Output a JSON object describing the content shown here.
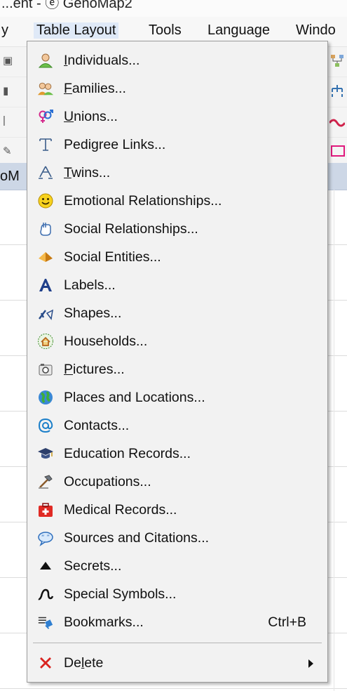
{
  "window": {
    "title_fragment": "...ent - ⓔ GenoMap2"
  },
  "menubar": {
    "items": [
      {
        "label": "y"
      },
      {
        "label": "Table Layout"
      },
      {
        "label": "Tools"
      },
      {
        "label": "Language"
      },
      {
        "label": "Windo"
      }
    ]
  },
  "column_header_fragment": "oM",
  "menu": {
    "items": [
      {
        "pre": "",
        "mnemonic": "I",
        "post": "ndividuals...",
        "icon": "person-icon"
      },
      {
        "pre": "",
        "mnemonic": "F",
        "post": "amilies...",
        "icon": "family-icon"
      },
      {
        "pre": "",
        "mnemonic": "U",
        "post": "nions...",
        "icon": "gender-symbols-icon"
      },
      {
        "pre": "Pedigree Links...",
        "mnemonic": "",
        "post": "",
        "icon": "pedigree-link-icon"
      },
      {
        "pre": "",
        "mnemonic": "T",
        "post": "wins...",
        "icon": "twins-icon"
      },
      {
        "pre": "Emotional Relationships...",
        "mnemonic": "",
        "post": "",
        "icon": "smiley-icon"
      },
      {
        "pre": "Social Relationships...",
        "mnemonic": "",
        "post": "",
        "icon": "hand-icon"
      },
      {
        "pre": "Social Entities...",
        "mnemonic": "",
        "post": "",
        "icon": "pyramid-icon"
      },
      {
        "pre": "Labels...",
        "mnemonic": "",
        "post": "",
        "icon": "letter-a-icon"
      },
      {
        "pre": "Shapes...",
        "mnemonic": "",
        "post": "",
        "icon": "shapes-icon"
      },
      {
        "pre": "Households...",
        "mnemonic": "",
        "post": "",
        "icon": "house-icon"
      },
      {
        "pre": "",
        "mnemonic": "P",
        "post": "ictures...",
        "icon": "camera-icon"
      },
      {
        "pre": "Places and Locations...",
        "mnemonic": "",
        "post": "",
        "icon": "globe-icon"
      },
      {
        "pre": "Contacts...",
        "mnemonic": "",
        "post": "",
        "icon": "at-sign-icon"
      },
      {
        "pre": "Education Records...",
        "mnemonic": "",
        "post": "",
        "icon": "graduation-cap-icon"
      },
      {
        "pre": "Occupations...",
        "mnemonic": "",
        "post": "",
        "icon": "hammer-icon"
      },
      {
        "pre": "Medical Records...",
        "mnemonic": "",
        "post": "",
        "icon": "medical-kit-icon"
      },
      {
        "pre": "Sources and Citations...",
        "mnemonic": "",
        "post": "",
        "icon": "quote-bubble-icon"
      },
      {
        "pre": "Secrets...",
        "mnemonic": "",
        "post": "",
        "icon": "triangle-icon"
      },
      {
        "pre": "Special Symbols...",
        "mnemonic": "",
        "post": "",
        "icon": "squiggle-icon"
      },
      {
        "pre": "Bookmarks...",
        "mnemonic": "",
        "post": "",
        "shortcut": "Ctrl+B",
        "icon": "bookmarks-icon"
      }
    ],
    "delete": {
      "pre": "De",
      "mnemonic": "l",
      "post": "ete",
      "icon": "red-x-icon"
    }
  },
  "colors": {
    "menu_bg": "#f2f2f2",
    "menu_border": "#9b9b9b",
    "header_bg": "#cdd7e6",
    "delete_red": "#d9231f"
  }
}
